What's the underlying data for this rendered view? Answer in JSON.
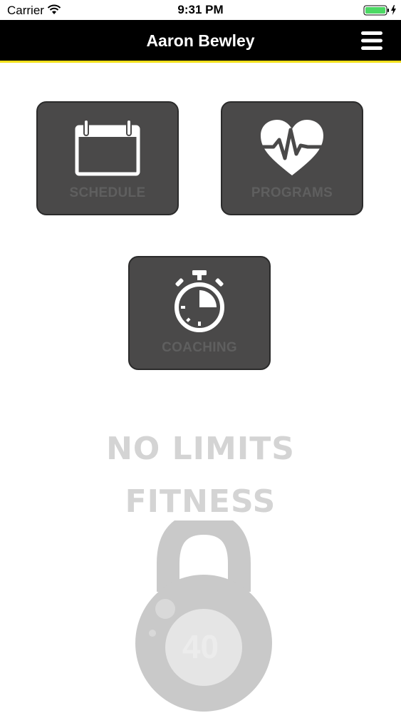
{
  "status_bar": {
    "carrier": "Carrier",
    "time": "9:31 PM"
  },
  "nav": {
    "title": "Aaron Bewley",
    "menu_icon": "hamburger-menu-icon"
  },
  "tiles": [
    {
      "label": "SCHEDULE",
      "icon": "calendar-icon"
    },
    {
      "label": "PROGRAMS",
      "icon": "heart-pulse-icon"
    },
    {
      "label": "COACHING",
      "icon": "stopwatch-icon"
    }
  ],
  "logo": {
    "line1": "NO LIMITS",
    "line2": "FITNESS",
    "kettlebell_weight": "40",
    "icon": "kettlebell-icon"
  },
  "colors": {
    "nav_background": "#000000",
    "accent": "#f2e11b",
    "tile_background": "#4a4949",
    "tile_label": "#5f5f5f",
    "logo": "#d4d4d4",
    "battery": "#4cd964"
  }
}
